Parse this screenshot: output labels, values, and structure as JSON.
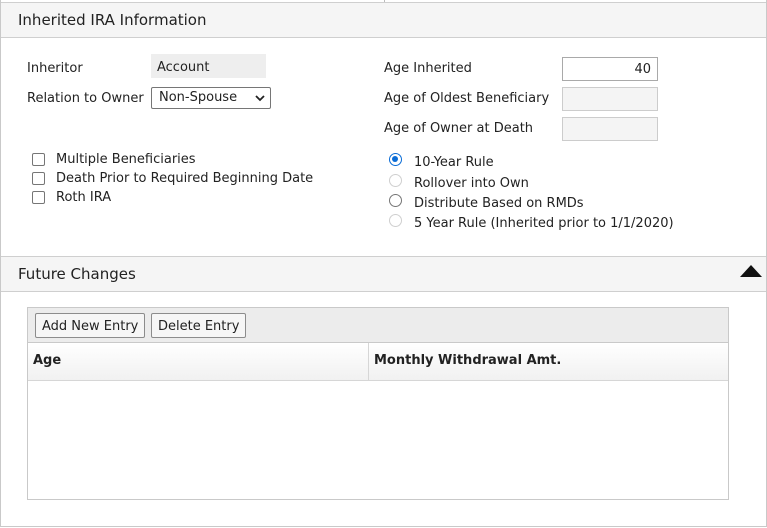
{
  "inherited": {
    "title": "Inherited IRA Information",
    "inheritor_label": "Inheritor",
    "inheritor_value": "Account",
    "relation_label": "Relation to Owner",
    "relation_value": "Non-Spouse",
    "age_inherited_label": "Age Inherited",
    "age_inherited_value": "40",
    "oldest_beneficiary_label": "Age of Oldest Beneficiary",
    "oldest_beneficiary_value": "",
    "owner_death_label": "Age of Owner at Death",
    "owner_death_value": "",
    "checkboxes": [
      {
        "label": "Multiple Beneficiaries",
        "checked": false
      },
      {
        "label": "Death Prior to Required Beginning Date",
        "checked": false
      },
      {
        "label": "Roth IRA",
        "checked": false
      }
    ],
    "radios": [
      {
        "label": "10-Year Rule",
        "checked": true,
        "enabled": true
      },
      {
        "label": "Rollover into Own",
        "checked": false,
        "enabled": false
      },
      {
        "label": "Distribute Based on RMDs",
        "checked": false,
        "enabled": true
      },
      {
        "label": "5 Year Rule (Inherited prior to 1/1/2020)",
        "checked": false,
        "enabled": false
      }
    ]
  },
  "future": {
    "title": "Future Changes",
    "add_label": "Add New Entry",
    "delete_label": "Delete Entry",
    "columns": [
      "Age",
      "Monthly Withdrawal Amt."
    ],
    "rows": []
  },
  "colors": {
    "accent": "#0a6cd6",
    "header_bg": "#f5f5f5",
    "border": "#c9c9c9"
  }
}
